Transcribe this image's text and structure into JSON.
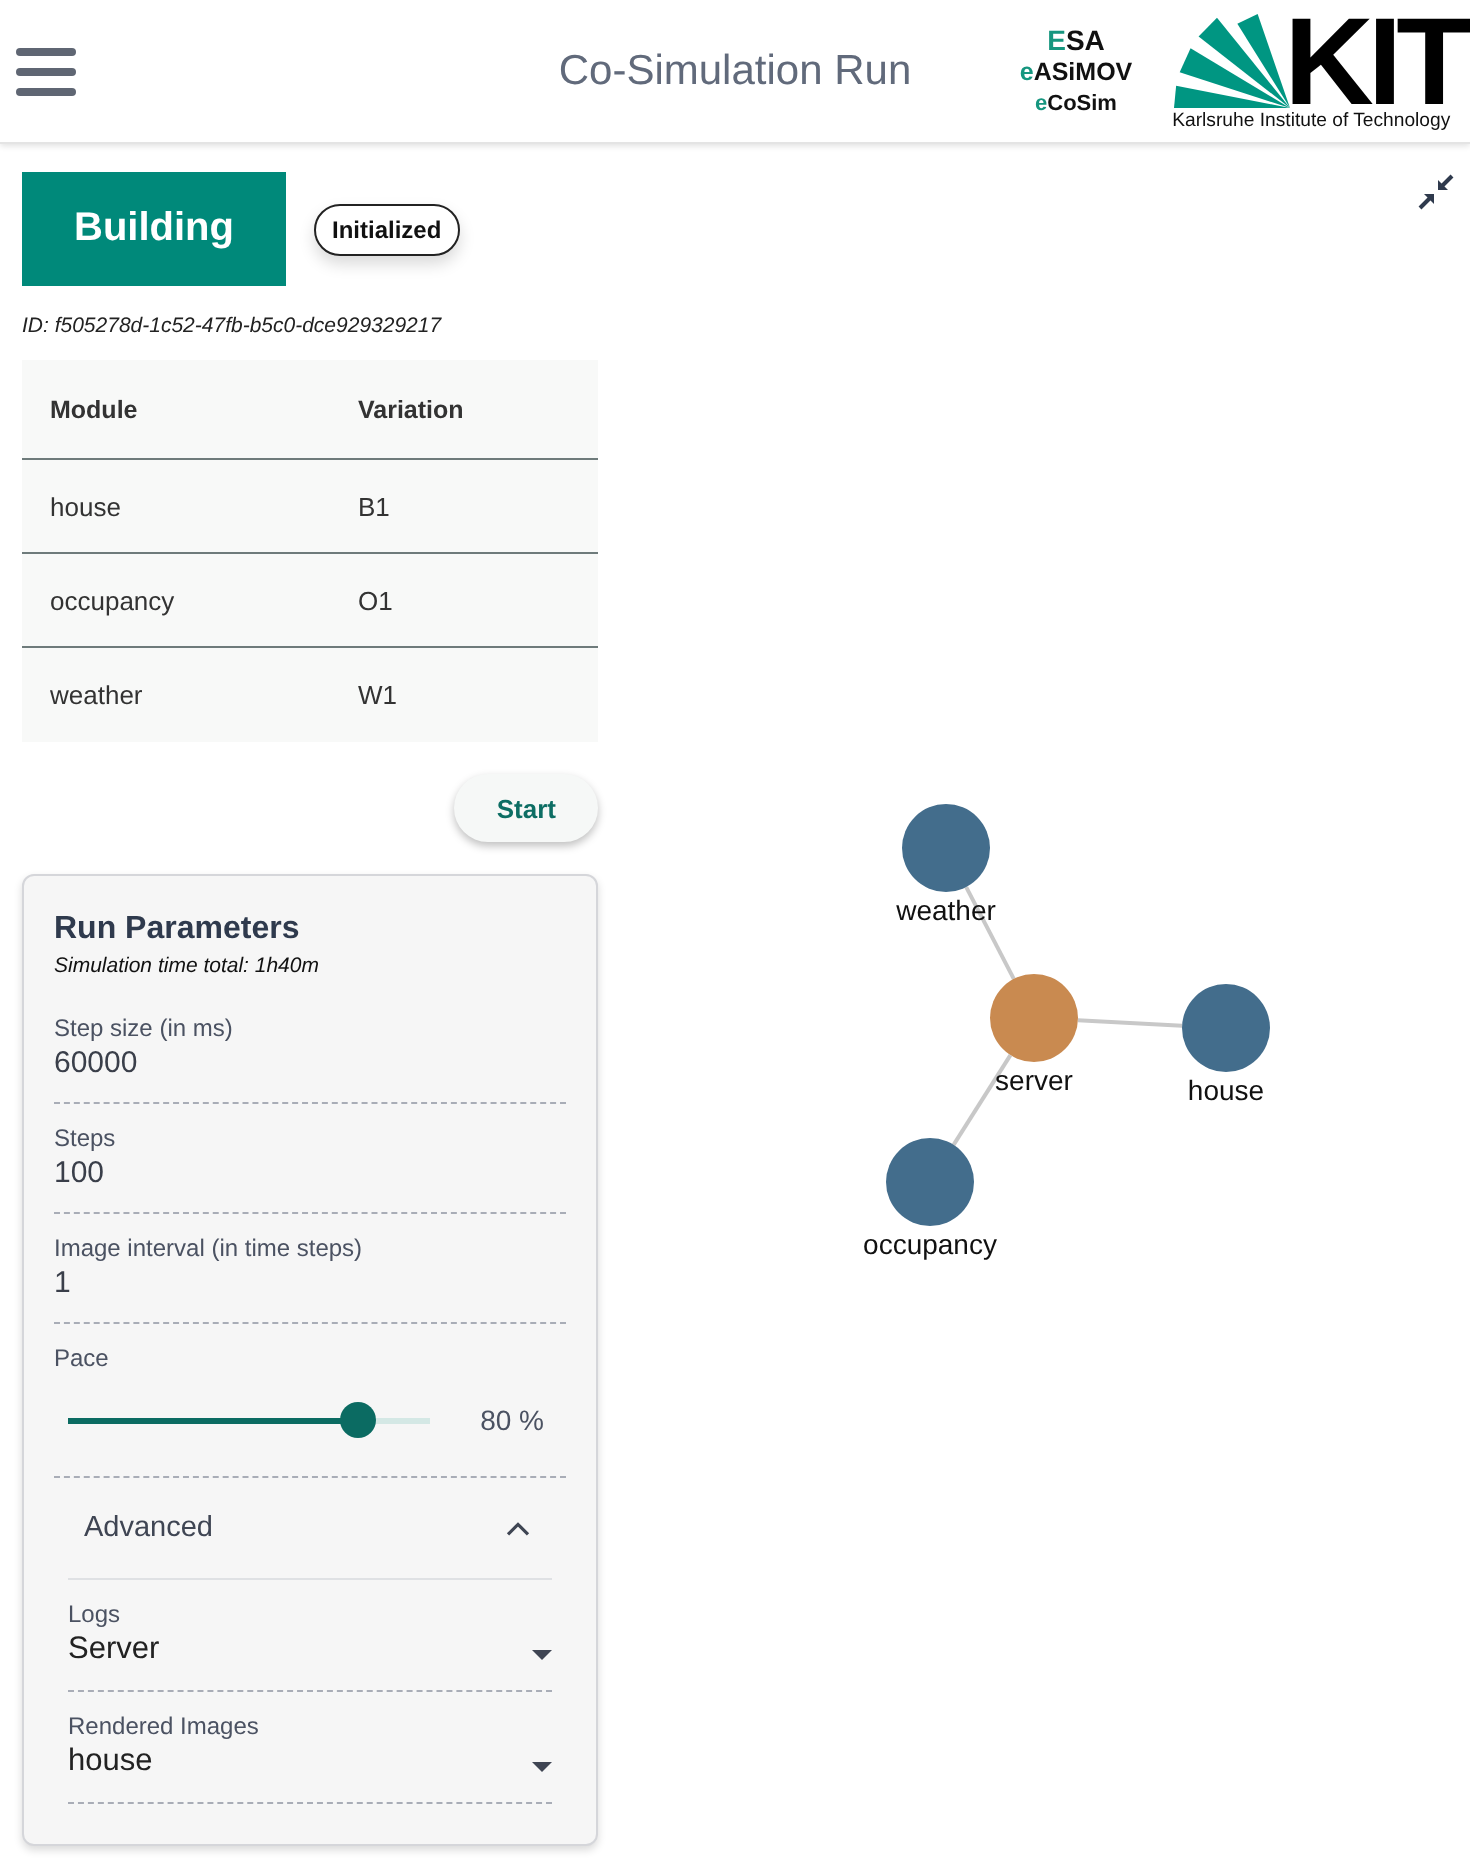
{
  "header": {
    "title": "Co-Simulation Run",
    "logo_stack": [
      "ESA",
      "eASiMOV",
      "eCoSim"
    ],
    "kit_logo": {
      "mark": "KIT",
      "caption": "Karlsruhe Institute of Technology"
    }
  },
  "run": {
    "name": "Building",
    "status": "Initialized",
    "id": "ID: f505278d-1c52-47fb-b5c0-dce929329217"
  },
  "modules_table": {
    "columns": [
      "Module",
      "Variation"
    ],
    "rows": [
      [
        "house",
        "B1"
      ],
      [
        "occupancy",
        "O1"
      ],
      [
        "weather",
        "W1"
      ]
    ]
  },
  "start_button": "Start",
  "run_parameters": {
    "title": "Run Parameters",
    "subtitle": "Simulation time total: 1h40m",
    "fields": [
      {
        "kind": "number",
        "label": "Step size (in ms)",
        "value": "60000"
      },
      {
        "kind": "number",
        "label": "Steps",
        "value": "100"
      },
      {
        "kind": "number",
        "label": "Image interval (in time steps)",
        "value": "1"
      },
      {
        "kind": "slider",
        "label": "Pace",
        "level": 0.8,
        "reading": "80 %"
      }
    ],
    "advanced": {
      "title": "Advanced",
      "expanded": true,
      "fields": [
        {
          "label": "Logs",
          "value": "Server"
        },
        {
          "label": "Rendered Images",
          "value": "house"
        }
      ]
    }
  },
  "graph": {
    "hub": {
      "label": "server"
    },
    "nodes": [
      {
        "label": "weather"
      },
      {
        "label": "house"
      },
      {
        "label": "occupancy"
      }
    ]
  }
}
